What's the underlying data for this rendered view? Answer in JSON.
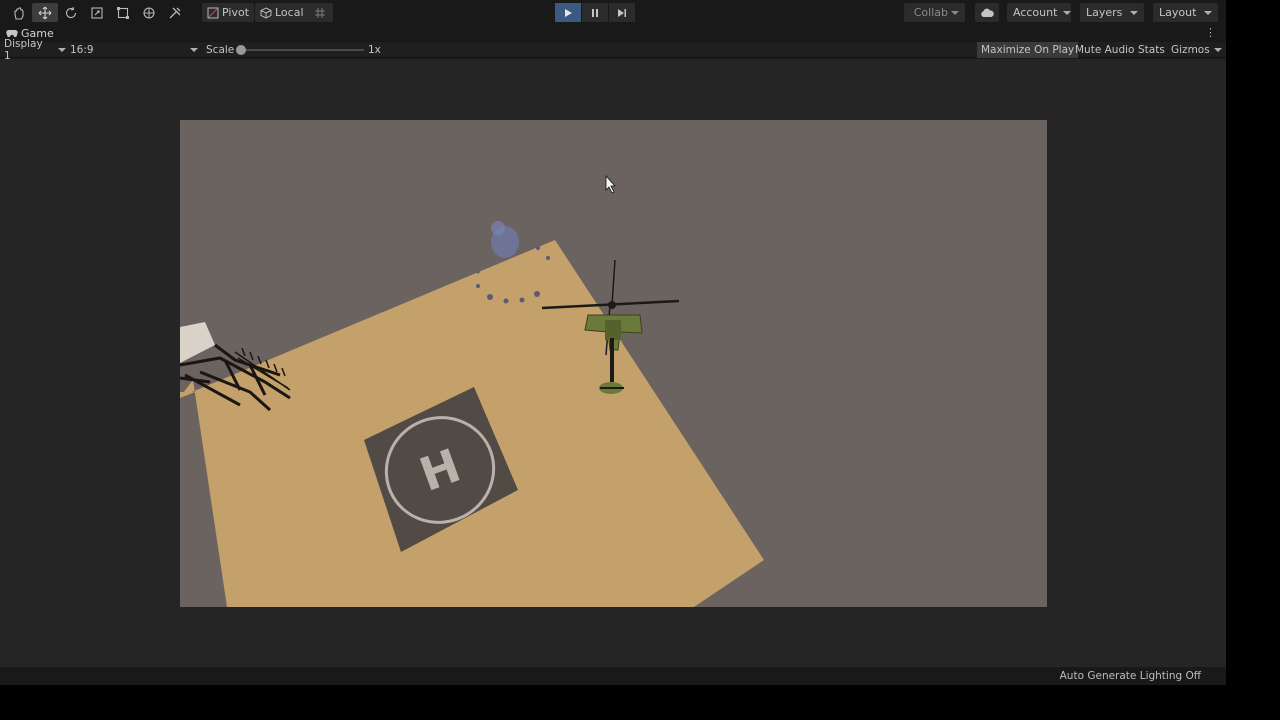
{
  "toolbar": {
    "tools": [
      "hand-tool",
      "move-tool",
      "rotate-tool",
      "scale-tool",
      "rect-tool",
      "transform-tool",
      "custom-tool"
    ],
    "pivot_label": "Pivot",
    "local_label": "Local",
    "collab_label": "Collab",
    "account_label": "Account",
    "layers_label": "Layers",
    "layout_label": "Layout"
  },
  "tab": {
    "label": "Game"
  },
  "controls": {
    "display_label": "Display 1",
    "aspect_label": "16:9",
    "scale_label": "Scale",
    "scale_value": "1x",
    "maximize_label": "Maximize On Play",
    "mute_label": "Mute Audio",
    "stats_label": "Stats",
    "gizmos_label": "Gizmos"
  },
  "scene": {
    "helipad_letter": "H",
    "ground_color": "#c4a06a",
    "background_color": "#6b6360",
    "helicopter_color": "#6b7a3a"
  },
  "status": {
    "lighting_label": "Auto Generate Lighting Off"
  },
  "colors": {
    "play_active": "#3a5a82"
  }
}
